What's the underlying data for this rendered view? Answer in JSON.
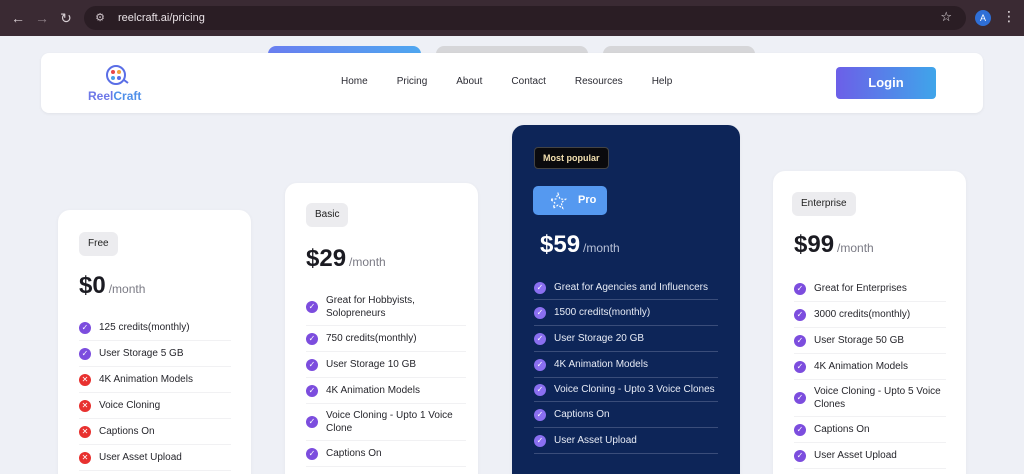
{
  "browser": {
    "url": "reelcraft.ai/pricing",
    "profile_initial": "A",
    "icons": [
      "back-arrow-icon",
      "forward-arrow-icon",
      "reload-icon",
      "site-settings-icon",
      "bookmark-star-icon",
      "kebab-menu-icon"
    ]
  },
  "header": {
    "logo": {
      "part1": "Reel",
      "part2": "Craft"
    },
    "menu": [
      "Home",
      "Pricing",
      "About",
      "Contact",
      "Resources",
      "Help"
    ],
    "login_label": "Login"
  },
  "colors": {
    "accent_purple": "#7c4dde",
    "pro_card_bg": "#0d2558",
    "cross_red": "#e8312f",
    "login_gradient_start": "#6c5fe8",
    "login_gradient_end": "#3fa5ea"
  },
  "plans": {
    "free": {
      "name": "Free",
      "price": "$0",
      "period": "/month",
      "features": [
        {
          "text": "125 credits(monthly)",
          "included": true
        },
        {
          "text": "User Storage 5 GB",
          "included": true
        },
        {
          "text": "4K Animation Models",
          "included": false
        },
        {
          "text": "Voice Cloning",
          "included": false
        },
        {
          "text": "Captions On",
          "included": false
        },
        {
          "text": "User Asset Upload",
          "included": false
        }
      ]
    },
    "basic": {
      "name": "Basic",
      "price": "$29",
      "period": "/month",
      "features": [
        {
          "text": "Great for Hobbyists, Solopreneurs",
          "included": true
        },
        {
          "text": "750 credits(monthly)",
          "included": true
        },
        {
          "text": "User Storage 10 GB",
          "included": true
        },
        {
          "text": "4K Animation Models",
          "included": true
        },
        {
          "text": "Voice Cloning - Upto 1 Voice Clone",
          "included": true
        },
        {
          "text": "Captions On",
          "included": true
        }
      ]
    },
    "pro": {
      "tag": "Most popular",
      "name": "Pro",
      "price": "$59",
      "period": "/month",
      "features": [
        {
          "text": "Great for Agencies and Influencers",
          "included": true
        },
        {
          "text": "1500 credits(monthly)",
          "included": true
        },
        {
          "text": "User Storage 20 GB",
          "included": true
        },
        {
          "text": "4K Animation Models",
          "included": true
        },
        {
          "text": "Voice Cloning - Upto 3 Voice Clones",
          "included": true
        },
        {
          "text": "Captions On",
          "included": true
        },
        {
          "text": "User Asset Upload",
          "included": true
        }
      ]
    },
    "enterprise": {
      "name": "Enterprise",
      "price": "$99",
      "period": "/month",
      "features": [
        {
          "text": "Great for Enterprises",
          "included": true
        },
        {
          "text": "3000 credits(monthly)",
          "included": true
        },
        {
          "text": "User Storage 50 GB",
          "included": true
        },
        {
          "text": "4K Animation Models",
          "included": true
        },
        {
          "text": "Voice Cloning - Upto 5 Voice Clones",
          "included": true
        },
        {
          "text": "Captions On",
          "included": true
        },
        {
          "text": "User Asset Upload",
          "included": true
        }
      ]
    }
  }
}
